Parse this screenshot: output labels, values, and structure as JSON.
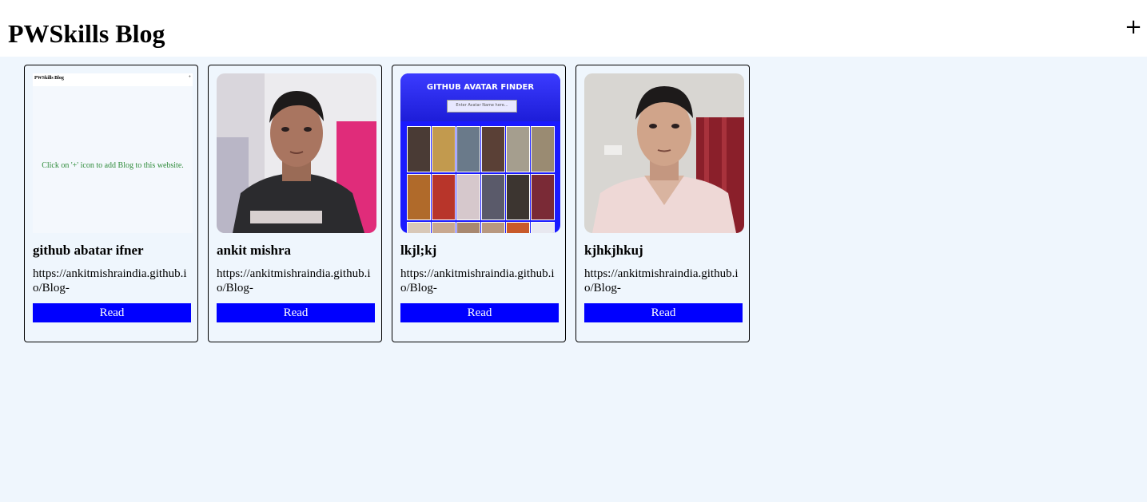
{
  "header": {
    "title": "PWSkills Blog",
    "add_label": "+"
  },
  "cards": [
    {
      "title": "github abatar ifner",
      "url": "https://ankitmishraindia.github.io/Blog-",
      "read_label": "Read",
      "thumb": {
        "header_title": "PWSkills Blog",
        "header_plus": "+",
        "message": "Click on '+' icon to add Blog to this website."
      }
    },
    {
      "title": "ankit mishra",
      "url": "https://ankitmishraindia.github.io/Blog-",
      "read_label": "Read"
    },
    {
      "title": "lkjl;kj",
      "url": "https://ankitmishraindia.github.io/Blog-",
      "read_label": "Read",
      "thumb": {
        "title": "GITHUB AVATAR FINDER",
        "placeholder": "Enter Avatar Name here..."
      }
    },
    {
      "title": "kjhkjhkuj",
      "url": "https://ankitmishraindia.github.io/Blog-",
      "read_label": "Read"
    }
  ],
  "colors": {
    "page_background": "#eff6fd",
    "header_background": "#ffffff",
    "read_button": "#0000ff"
  }
}
